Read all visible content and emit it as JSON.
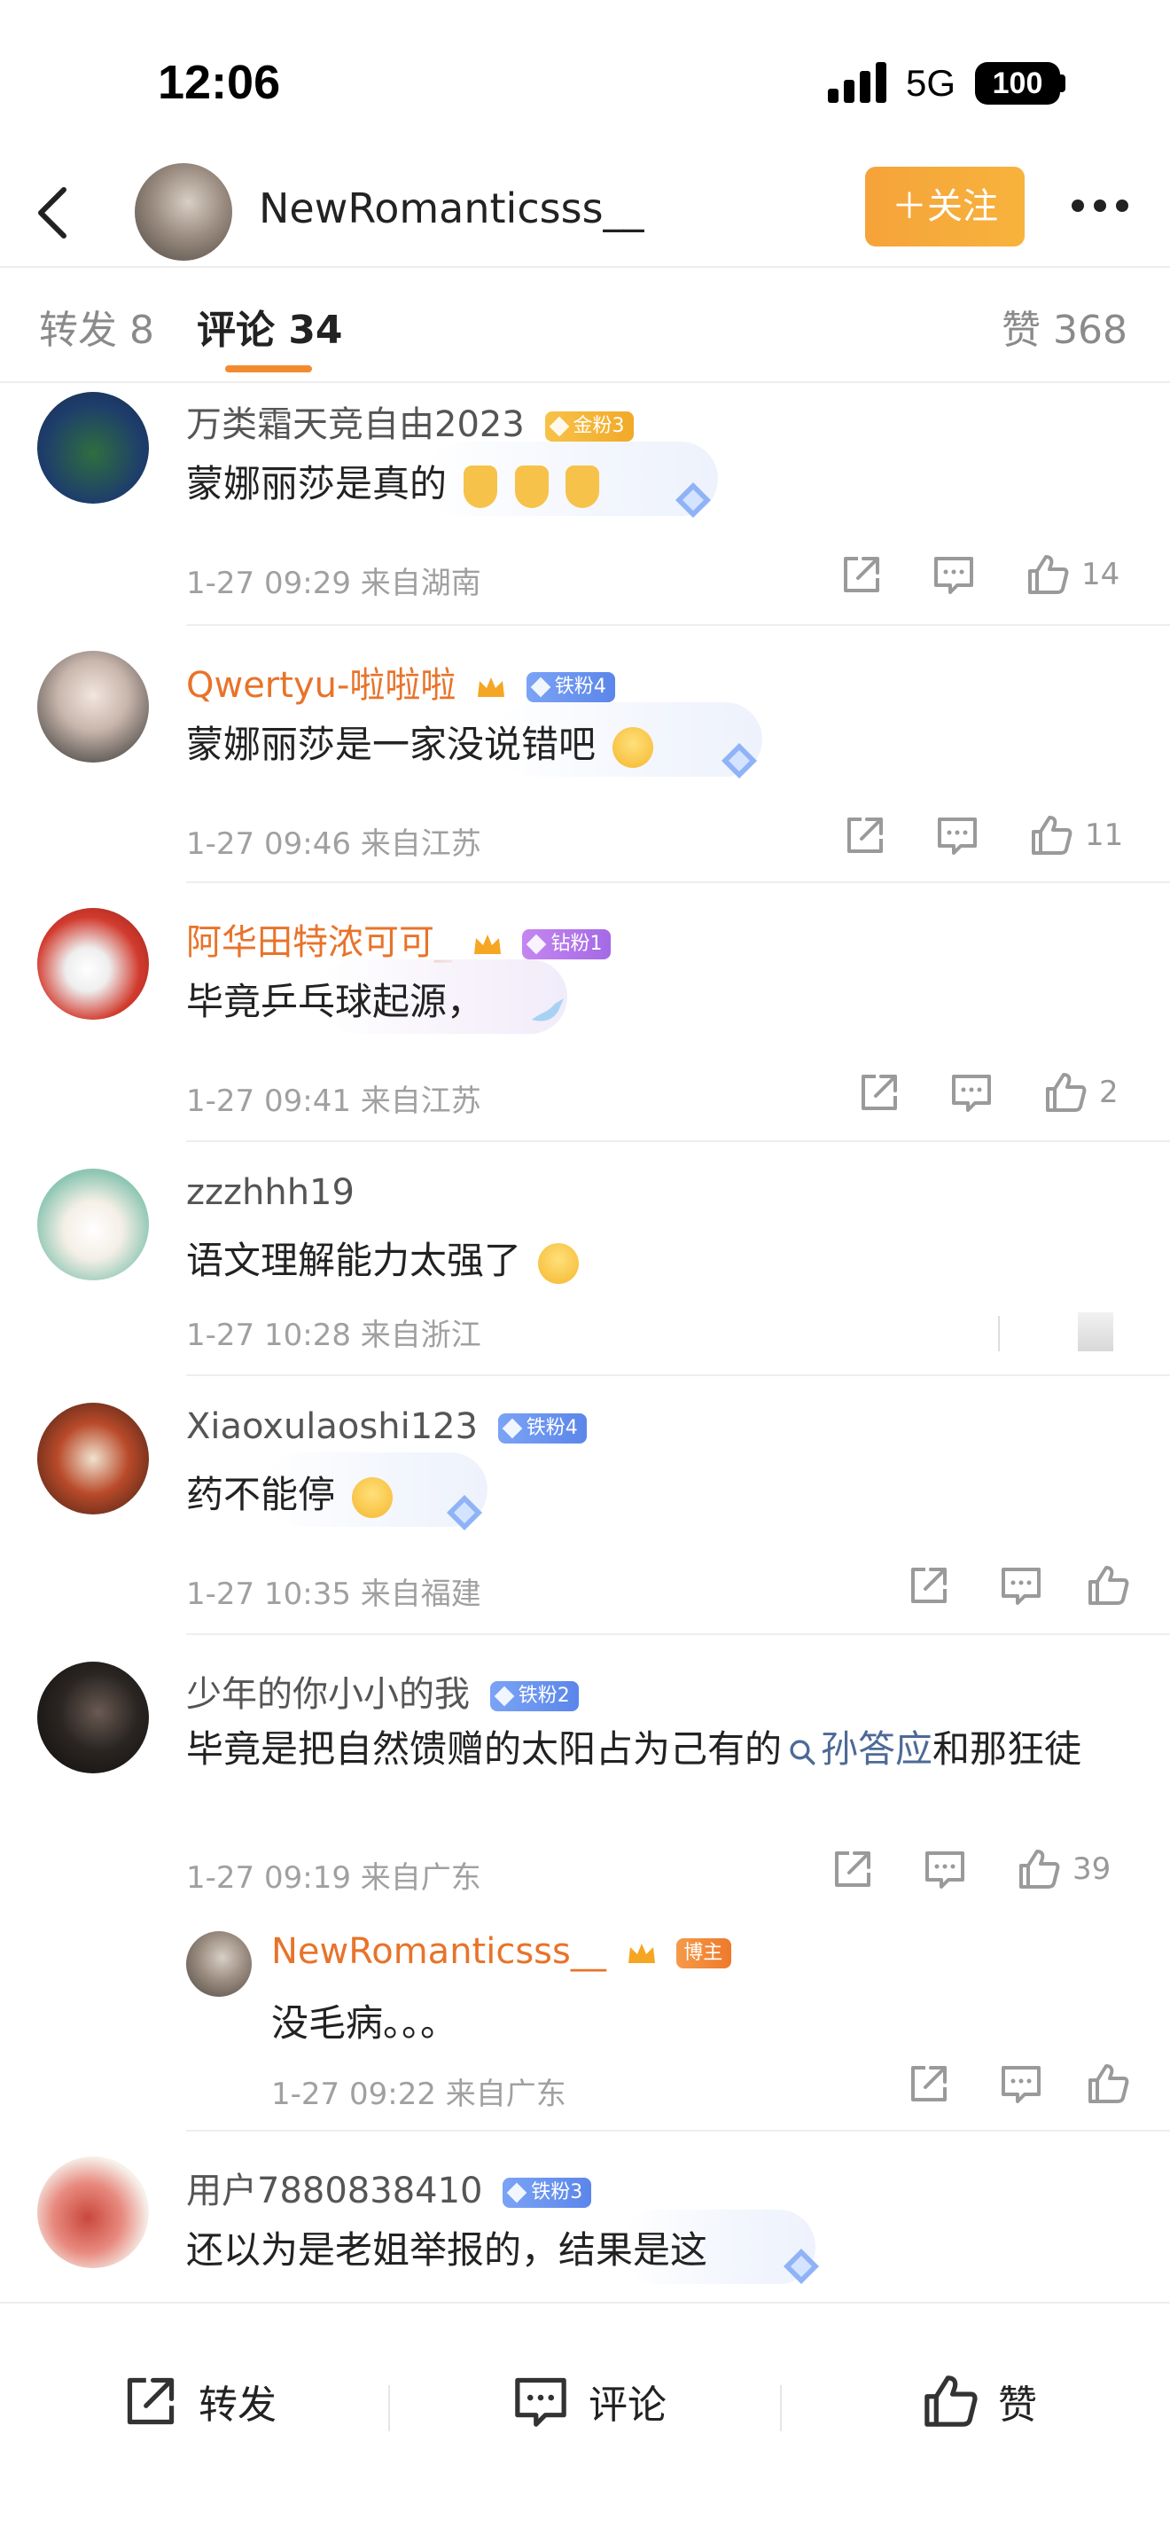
{
  "status_bar": {
    "time": "12:06",
    "network": "5G",
    "battery": "100"
  },
  "header": {
    "username": "NewRomanticsss__",
    "follow_label": "＋关注"
  },
  "tabs": {
    "repost": "转发 8",
    "comment": "评论 34",
    "like": "赞 368"
  },
  "comments": [
    {
      "user": "万类霜天竞自由2023",
      "badge": "金粉3",
      "text": "蒙娜丽莎是真的",
      "meta": "1-27 09:29  来自湖南",
      "likes": "14"
    },
    {
      "user": "Qwertyu-啦啦啦",
      "badge": "铁粉4",
      "text": "蒙娜丽莎是一家没说错吧",
      "meta": "1-27 09:46  来自江苏",
      "likes": "11"
    },
    {
      "user": "阿华田特浓可可_",
      "badge": "钻粉1",
      "text": "毕竟乒乓球起源，",
      "meta": "1-27 09:41  来自江苏",
      "likes": "2"
    },
    {
      "user": "zzzhhh19",
      "text": "语文理解能力太强了",
      "meta": "1-27 10:28  来自浙江"
    },
    {
      "user": "Xiaoxulaoshi123",
      "badge": "铁粉4",
      "text": "药不能停",
      "meta": "1-27 10:35  来自福建"
    },
    {
      "user": "少年的你小小的我",
      "badge": "铁粉2",
      "text_before": "毕竟是把自然馈赠的太阳占为己有的",
      "mention": "孙答应",
      "text_after": "和那狂徒",
      "meta": "1-27 09:19  来自广东",
      "likes": "39",
      "reply": {
        "user": "NewRomanticsss__",
        "badge": "博主",
        "text": "没毛病。。。",
        "meta": "1-27 09:22  来自广东"
      }
    },
    {
      "user": "用户7880838410",
      "badge": "铁粉3",
      "text": "还以为是老姐举报的，结果是这"
    }
  ],
  "bottom_bar": {
    "repost": "转发",
    "comment": "评论",
    "like": "赞"
  },
  "colors": {
    "accent_orange": "#f5a623",
    "vip_name": "#e8732a",
    "tab_underline": "#f28b2f",
    "mention": "#4d6a96"
  },
  "icons": [
    "back-icon",
    "more-icon",
    "share-icon",
    "comment-icon",
    "like-icon"
  ]
}
